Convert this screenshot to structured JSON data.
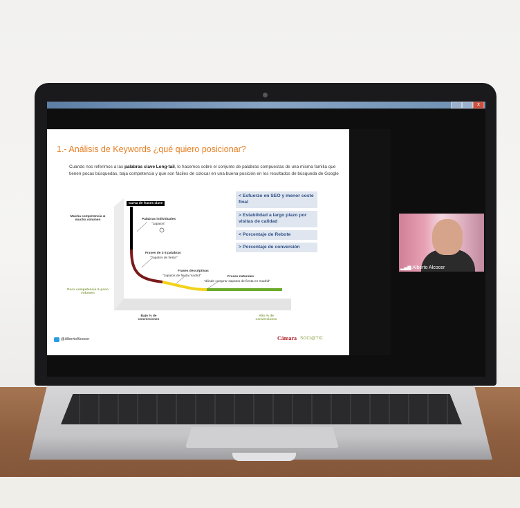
{
  "slide": {
    "title": "1.- Análisis de Keywords ¿qué quiero posicionar?",
    "body_pre": "Cuando nos referimos a las ",
    "body_bold": "palabras clave Long-tail",
    "body_post": ", lo hacemos sobre el conjunto de palabras compuestas de una misma familia que tienen pocas búsquedas, baja competencia y que son fáciles de colocar en una buena posición en los resultados de búsqueda de Google",
    "chart_header": "Curva de frases clave",
    "y_high": "Mucha competencia & mucho volumen",
    "y_low": "Poca competencia & poco volumen",
    "x_low": "Bajo % de conversiones",
    "x_high": "Alto % de conversiones",
    "seg1_title": "Palabras individuales",
    "seg1_example": "\"zapatos\"",
    "seg2_title": "Frases de 2-3 palabras",
    "seg2_example": "\"zapatos de fiesta\"",
    "seg3_title": "Frases descriptivas",
    "seg3_example": "\"zapatos de fiesta madrid\"",
    "seg4_title": "Frases naturales",
    "seg4_example": "\"dónde comprar zapatos de fiesta en madrid\"",
    "box1": "< Esfuerzo en SEO y menor coste final",
    "box2": "> Estabilidad a largo plazo por visitas de calidad",
    "box3": "< Porcentaje de Rebote",
    "box4": "> Porcentaje de conversión",
    "twitter_handle": "@AlbertoAlcocer",
    "logo_camara": "Cámara",
    "logo_sociotic": "SOCI@TIC"
  },
  "video": {
    "participant_name": "Alberto Alcocer"
  },
  "window": {
    "close_glyph": "x"
  },
  "colors": {
    "title_orange": "#e67e22",
    "curve_black": "#000000",
    "curve_darkred": "#7a1a1a",
    "curve_yellow": "#f2d21b",
    "curve_green": "#6bab2a",
    "box_text": "#2f4f84"
  }
}
